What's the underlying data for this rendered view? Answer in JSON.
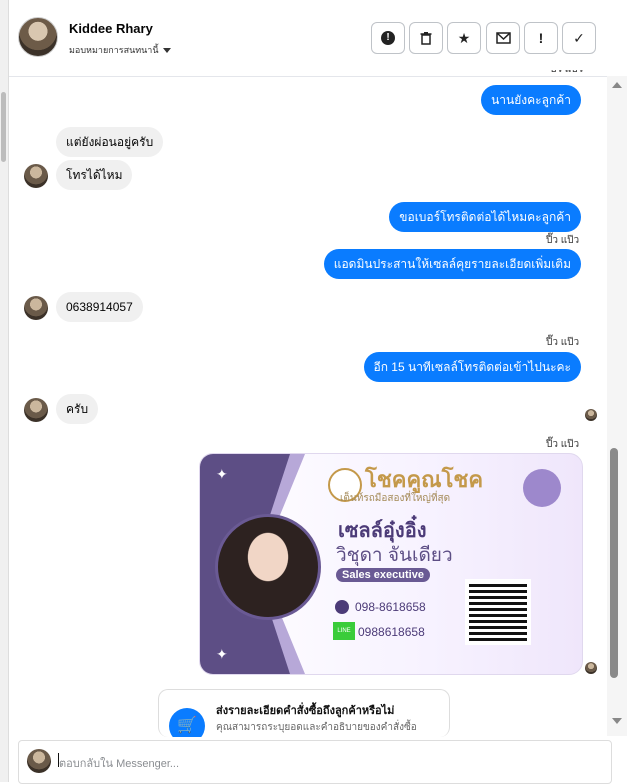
{
  "header": {
    "name": "Kiddee Rhary",
    "assign": "มอบหมายการสนทนานี้",
    "toolbar": [
      {
        "name": "spam-button",
        "glyph": "!",
        "label": "spam"
      },
      {
        "name": "delete-button",
        "glyph": "🗑",
        "label": "delete"
      },
      {
        "name": "star-button",
        "glyph": "★",
        "label": "star"
      },
      {
        "name": "mark-unread-button",
        "glyph": "✉",
        "label": "mark unread"
      },
      {
        "name": "follow-up-button",
        "glyph": "!",
        "label": "follow up"
      },
      {
        "name": "done-button",
        "glyph": "✓",
        "label": "done"
      }
    ]
  },
  "messages": {
    "seen_top": "ปี๊ว แป๊ว",
    "m1": "นานยังคะลูกค้า",
    "m2": "แต่ยังผ่อนอยู่ครับ",
    "m3": "โทรได้ไหม",
    "m4": "ขอเบอร์โทรติดต่อได้ไหมคะลูกค้า",
    "seen1": "ปี๊ว แป๊ว",
    "m5": "แอดมินประสานให้เซลล์คุยรายละเอียดเพิ่มเติม",
    "m6": "0638914057",
    "seen2": "ปี๊ว แป๊ว",
    "m7": "อีก 15 นาทีเซลล์โทรติดต่อเข้าไปนะคะ",
    "m8": "ครับ",
    "seen3": "ปี๊ว แป๊ว"
  },
  "card": {
    "brand": "โชคคูณโชค",
    "brand_sub": "เต็นท์รถมือสองที่ใหญ่ที่สุด",
    "nick": "เซลล์อุ๋งอิ๋ง",
    "fullname": "วิชุดา จันเดียว",
    "role": "Sales executive",
    "phone": "098-8618658",
    "line_badge": "LINE",
    "line_id": "0988618658"
  },
  "order": {
    "title": "ส่งรายละเอียดคำสั่งซื้อถึงลูกค้าหรือไม่",
    "desc": "คุณสามารถระบุยอดและคำอธิบายของคำสั่งซื้อ"
  },
  "composer": {
    "placeholder": "ตอบกลับใน Messenger..."
  },
  "colors": {
    "outgoing": "#0a7cff",
    "incoming": "#f0f0f0"
  }
}
